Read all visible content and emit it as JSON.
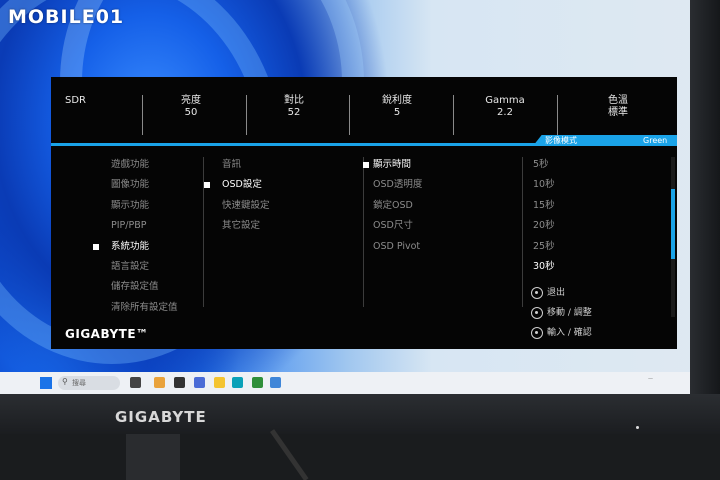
{
  "watermark": "MOBILE01",
  "bezel_brand": "GIGABYTE",
  "osd_brand": "GIGABYTE™",
  "taskbar": {
    "search_placeholder": "搜尋"
  },
  "status": [
    {
      "label": "SDR",
      "value": ""
    },
    {
      "label": "亮度",
      "value": "50"
    },
    {
      "label": "對比",
      "value": "52"
    },
    {
      "label": "銳利度",
      "value": "5"
    },
    {
      "label": "Gamma",
      "value": "2.2"
    },
    {
      "label": "色溫",
      "value": "標準"
    }
  ],
  "mode": {
    "label": "影像模式",
    "value": "Green"
  },
  "menu_main": [
    "遊戲功能",
    "圖像功能",
    "顯示功能",
    "PIP/PBP",
    "系統功能",
    "語言設定",
    "儲存設定值",
    "清除所有設定值"
  ],
  "menu_sub": [
    "音訊",
    "OSD設定",
    "快速鍵設定",
    "其它設定"
  ],
  "menu_osd": [
    "顯示時間",
    "OSD透明度",
    "鎖定OSD",
    "OSD尺寸",
    "OSD Pivot"
  ],
  "menu_values": [
    "5秒",
    "10秒",
    "15秒",
    "20秒",
    "25秒",
    "30秒"
  ],
  "help": [
    "退出",
    "移動 / 調整",
    "輸入 / 確認"
  ],
  "colors": {
    "accent": "#1aa3e8",
    "osd_bg": "#050505"
  }
}
